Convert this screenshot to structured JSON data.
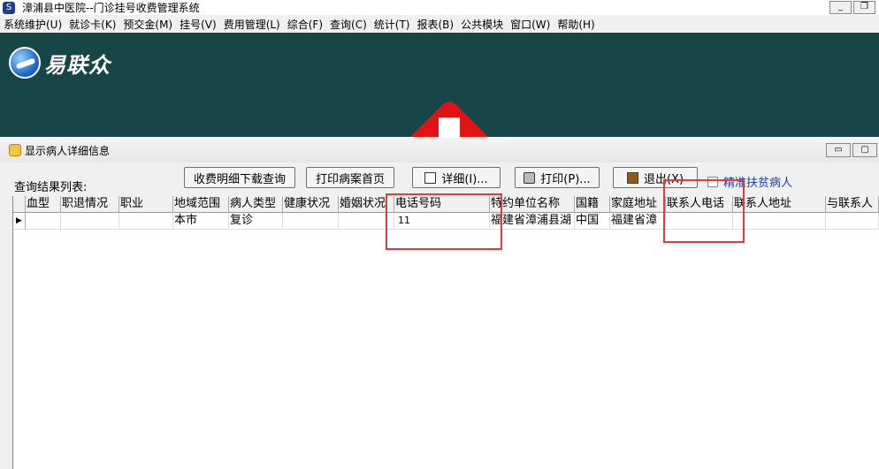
{
  "app": {
    "title": "漳浦县中医院--门诊挂号收费管理系统",
    "window_buttons": [
      "_",
      "❐"
    ]
  },
  "menu": [
    "系统维护(U)",
    "就诊卡(K)",
    "预交金(M)",
    "挂号(V)",
    "费用管理(L)",
    "综合(F)",
    "查询(C)",
    "统计(T)",
    "报表(B)",
    "公共模块",
    "窗口(W)",
    "帮助(H)"
  ],
  "banner": {
    "logo_text": "易联众"
  },
  "child_window": {
    "title": "显示病人详细信息",
    "buttons": [
      "▭",
      "▢"
    ]
  },
  "toolbar": {
    "query_label": "查询结果列表:",
    "fee_detail": "收费明细下载查询",
    "print_record": "打印病案首页",
    "detail": "详细(I)...",
    "print": "打印(P)...",
    "exit": "退出(X)",
    "poverty": "精准扶贫病人"
  },
  "grid": {
    "columns": [
      "血型",
      "职退情况",
      "职业",
      "地域范围",
      "病人类型",
      "健康状况",
      "婚姻状况",
      "电话号码",
      "特约单位名称",
      "国籍",
      "家庭地址",
      "联系人电话",
      "联系人地址",
      "与联系人"
    ],
    "rows": [
      [
        "",
        "",
        "",
        "本市",
        "复诊",
        "",
        "",
        "11",
        "福建省漳浦县湖",
        "中国",
        "福建省漳",
        "",
        "",
        ""
      ]
    ],
    "row_indicator": "▶"
  },
  "colors": {
    "highlight": "#e23b3b",
    "banner": "#174648",
    "link": "#1b3fa6"
  }
}
